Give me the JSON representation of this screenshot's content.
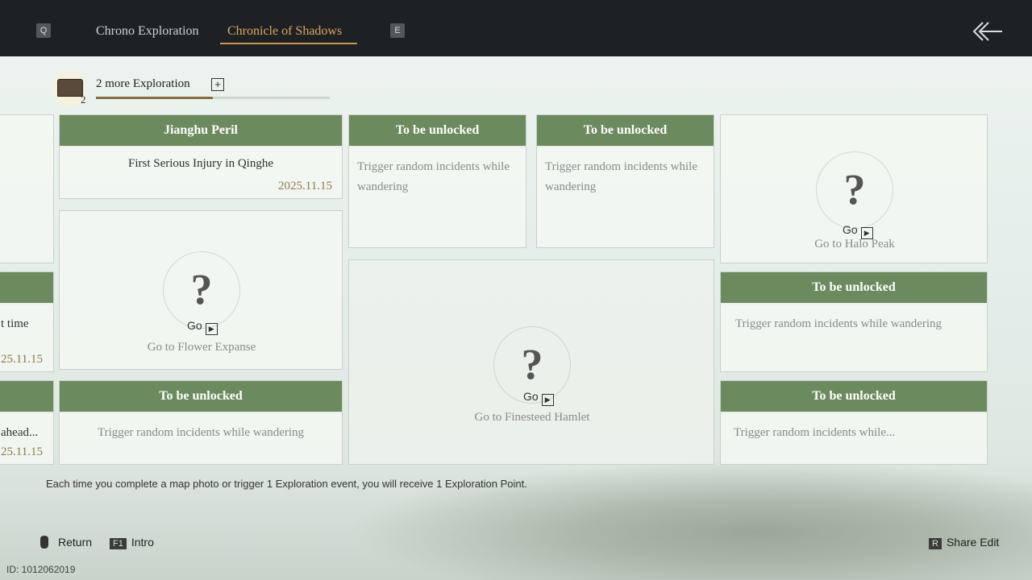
{
  "header": {
    "key_left": "Q",
    "key_right": "E",
    "tabs": [
      {
        "label": "Chrono Exploration"
      },
      {
        "label": "Chronicle of Shadows"
      }
    ],
    "back_icon": "double-chevron-back-icon"
  },
  "exploration": {
    "count": "2",
    "label": "2 more Exploration",
    "plus": "+",
    "progress": 0.5
  },
  "cards": {
    "left_partial": [
      {
        "body": "t time",
        "date": "25.11.15"
      },
      {
        "body": "ahead...",
        "date": "25.11.15"
      }
    ],
    "jianghu": {
      "title": "Jianghu Peril",
      "subtitle": "First Serious Injury in Qinghe",
      "date": "2025.11.15"
    },
    "locked_a": {
      "title": "To be unlocked",
      "body": "Trigger random incidents while wandering"
    },
    "locked_b": {
      "title": "To be unlocked",
      "body": "Trigger random incidents while wandering"
    },
    "halo": {
      "go": "Go",
      "destination": "Go to Halo Peak"
    },
    "flower": {
      "go": "Go",
      "destination": "Go to Flower Expanse"
    },
    "finesteed": {
      "go": "Go",
      "destination": "Go to Finesteed Hamlet"
    },
    "locked_c": {
      "title": "To be unlocked",
      "body": "Trigger random incidents while wandering"
    },
    "locked_d": {
      "title": "To be unlocked",
      "body": "Trigger random incidents while wandering"
    },
    "locked_e": {
      "title": "To be unlocked",
      "body": "Trigger random incidents while..."
    }
  },
  "footer": {
    "note": "Each time you complete a map photo or trigger 1 Exploration event, you will receive 1 Exploration Point.",
    "return_label": "Return",
    "intro_key": "F1",
    "intro_label": "Intro",
    "share_key": "R",
    "share_label": "Share Edit",
    "id": "ID: 1012062019"
  }
}
